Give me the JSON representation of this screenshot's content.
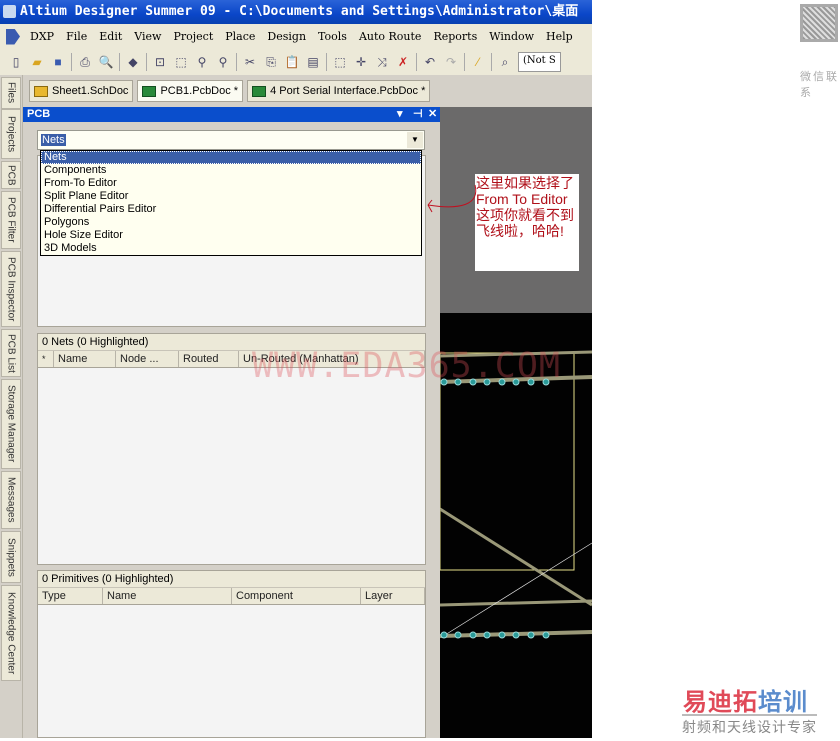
{
  "title": "Altium Designer Summer 09 - C:\\Documents and Settings\\Administrator\\桌面",
  "menu": [
    "DXP",
    "File",
    "Edit",
    "View",
    "Project",
    "Place",
    "Design",
    "Tools",
    "Auto Route",
    "Reports",
    "Window",
    "Help"
  ],
  "toolbar": {
    "combo_value": "(Not S"
  },
  "side_tabs": [
    "Files",
    "Projects",
    "PCB",
    "PCB Filter",
    "PCB Inspector",
    "PCB List",
    "Storage Manager",
    "Messages",
    "Snippets",
    "Knowledge Center"
  ],
  "doc_tabs": [
    {
      "label": "Sheet1.SchDoc"
    },
    {
      "label": "PCB1.PcbDoc *"
    },
    {
      "label": "4 Port Serial Interface.PcbDoc *"
    }
  ],
  "panel": {
    "title": "PCB",
    "combo_value": "Nets",
    "options": [
      "Nets",
      "Components",
      "From-To Editor",
      "Split Plane Editor",
      "Differential Pairs Editor",
      "Polygons",
      "Hole Size Editor",
      "3D Models"
    ],
    "nets": {
      "header": "0 Nets (0 Highlighted)",
      "columns": [
        "*",
        "Name",
        "Node ...",
        "Routed",
        "Un-Routed (Manhattan)"
      ]
    },
    "primitives": {
      "header": "0 Primitives (0 Highlighted)",
      "columns": [
        "Type",
        "Name",
        "Component",
        "Layer"
      ]
    }
  },
  "annotation": "这里如果选择了From To Editor这项你就看不到飞线啦，哈哈!",
  "watermark": "WWW.EDA365.COM",
  "qr_label": "微信联系",
  "logo": {
    "main_red": "易迪拓",
    "main_blue": "培训",
    "sub": "射频和天线设计专家"
  },
  "colors": {
    "title_blue": "#0a46c8",
    "selection": "#3b5fa8",
    "annotation_red": "#b0101a",
    "pad": "#2a9a98"
  }
}
